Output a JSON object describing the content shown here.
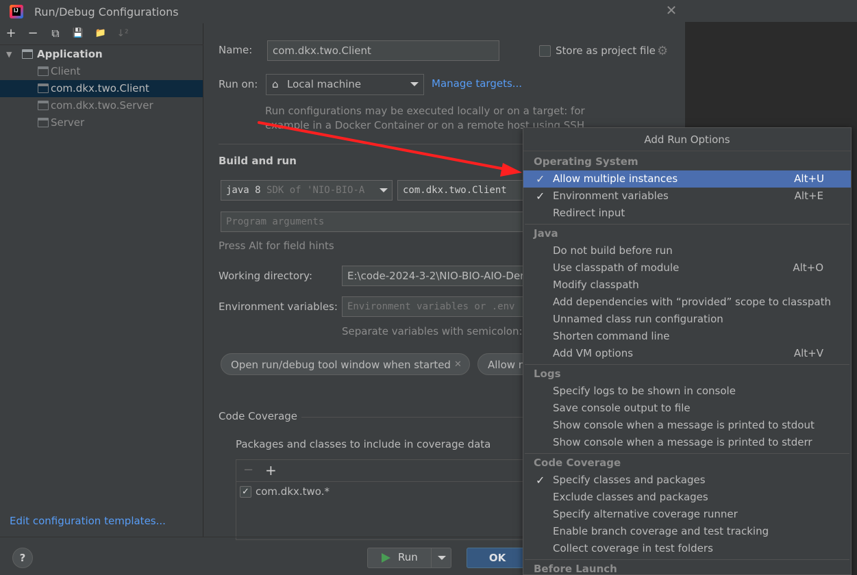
{
  "window": {
    "title": "Run/Debug Configurations",
    "close_icon": "close-icon"
  },
  "toolbar": {
    "add_icon": "+",
    "remove_icon": "−",
    "copy_icon": "⧉",
    "save_icon": "💾",
    "folder_icon": "📁",
    "sort_icon": "↓²"
  },
  "tree": {
    "root_label": "Application",
    "items": [
      {
        "label": "Client",
        "selected": false
      },
      {
        "label": "com.dkx.two.Client",
        "selected": true
      },
      {
        "label": "com.dkx.two.Server",
        "selected": false
      },
      {
        "label": "Server",
        "selected": false
      }
    ]
  },
  "edit_templates_link": "Edit configuration templates...",
  "form": {
    "name_label": "Name:",
    "name_value": "com.dkx.two.Client",
    "store_label": "Store as project file",
    "run_on_label": "Run on:",
    "run_on_value": "Local machine",
    "manage_targets": "Manage targets...",
    "run_on_hint_1": "Run configurations may be executed locally or on a target: for",
    "run_on_hint_2": "example in a Docker Container or on a remote host using SSH.",
    "build_run_title": "Build and run",
    "sdk_value": "java 8",
    "sdk_hint": "SDK of 'NIO-BIO-A",
    "main_class": "com.dkx.two.Client",
    "program_args_placeholder": "Program arguments",
    "alt_hint": "Press Alt for field hints",
    "working_dir_label": "Working directory:",
    "working_dir_value": "E:\\code-2024-3-2\\NIO-BIO-AIO-Der",
    "env_label": "Environment variables:",
    "env_placeholder": "Environment variables or .env",
    "env_hint": "Separate variables with semicolon: V",
    "chip_open_tool": "Open run/debug tool window when started",
    "chip_allow": "Allow m",
    "coverage_title": "Code Coverage",
    "coverage_packages_label": "Packages and classes to include in coverage data",
    "coverage_minus": "−",
    "coverage_plus": "+",
    "coverage_entry": "com.dkx.two.*"
  },
  "buttons": {
    "help": "?",
    "run": "Run",
    "ok": "OK"
  },
  "popup": {
    "title": "Add Run Options",
    "groups": [
      {
        "name": "Operating System"
      },
      {
        "name": "Java"
      },
      {
        "name": "Logs"
      },
      {
        "name": "Code Coverage"
      },
      {
        "name": "Before Launch"
      }
    ],
    "items": [
      {
        "label": "Allow multiple instances",
        "checked": true,
        "shortcut": "Alt+U",
        "selected": true
      },
      {
        "label": "Environment variables",
        "checked": true,
        "shortcut": "Alt+E"
      },
      {
        "label": "Redirect input",
        "checked": false,
        "shortcut": ""
      },
      {
        "label": "Do not build before run",
        "checked": false,
        "shortcut": ""
      },
      {
        "label": "Use classpath of module",
        "checked": false,
        "shortcut": "Alt+O"
      },
      {
        "label": "Modify classpath",
        "checked": false,
        "shortcut": ""
      },
      {
        "label": "Add dependencies with “provided” scope to classpath",
        "checked": false,
        "shortcut": ""
      },
      {
        "label": "Unnamed class run configuration",
        "checked": false,
        "shortcut": ""
      },
      {
        "label": "Shorten command line",
        "checked": false,
        "shortcut": ""
      },
      {
        "label": "Add VM options",
        "checked": false,
        "shortcut": "Alt+V"
      },
      {
        "label": "Specify logs to be shown in console",
        "checked": false,
        "shortcut": ""
      },
      {
        "label": "Save console output to file",
        "checked": false,
        "shortcut": ""
      },
      {
        "label": "Show console when a message is printed to stdout",
        "checked": false,
        "shortcut": ""
      },
      {
        "label": "Show console when a message is printed to stderr",
        "checked": false,
        "shortcut": ""
      },
      {
        "label": "Specify classes and packages",
        "checked": true,
        "shortcut": ""
      },
      {
        "label": "Exclude classes and packages",
        "checked": false,
        "shortcut": ""
      },
      {
        "label": "Specify alternative coverage runner",
        "checked": false,
        "shortcut": ""
      },
      {
        "label": "Enable branch coverage and test tracking",
        "checked": false,
        "shortcut": ""
      },
      {
        "label": "Collect coverage in test folders",
        "checked": false,
        "shortcut": ""
      }
    ],
    "check_glyph": "✓"
  },
  "colors": {
    "accent": "#4b6eaf",
    "link": "#589df6",
    "annotation_arrow": "#ff2020"
  }
}
